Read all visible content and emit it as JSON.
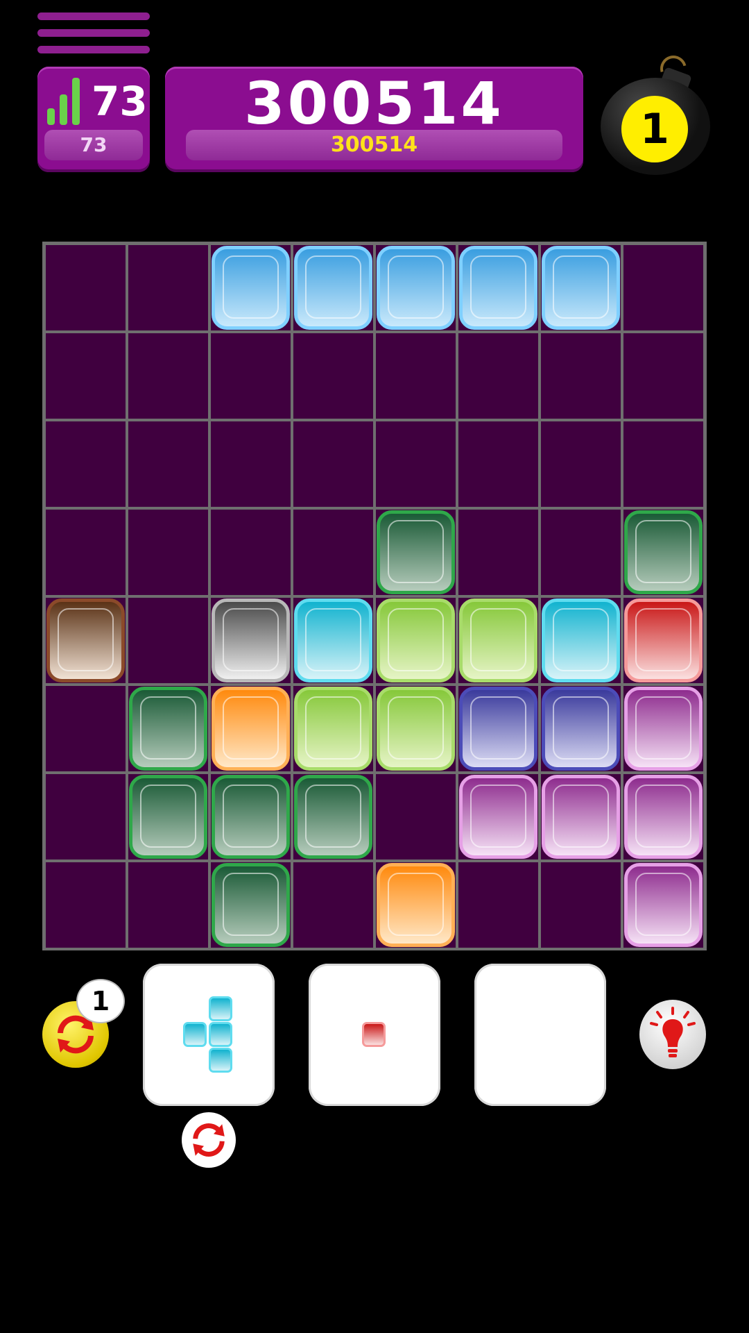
{
  "hud": {
    "level": "73",
    "level_sub": "73",
    "score": "300514",
    "best_score": "300514",
    "bombs": "1"
  },
  "board": {
    "cols": 8,
    "rows": 8,
    "cells": [
      [
        null,
        null,
        "lightblue",
        "lightblue",
        "lightblue",
        "lightblue",
        "lightblue",
        null
      ],
      [
        null,
        null,
        null,
        null,
        null,
        null,
        null,
        null
      ],
      [
        null,
        null,
        null,
        null,
        null,
        null,
        null,
        null
      ],
      [
        null,
        null,
        null,
        null,
        "darkgreen",
        null,
        null,
        "darkgreen"
      ],
      [
        "brown",
        null,
        "gray",
        "cyan",
        "lime",
        "lime",
        "cyan",
        "red"
      ],
      [
        null,
        "darkgreen",
        "orange",
        "lime",
        "lime",
        "indigo",
        "indigo",
        "purple"
      ],
      [
        null,
        "darkgreen",
        "darkgreen",
        "darkgreen",
        null,
        "purple",
        "purple",
        "purple"
      ],
      [
        null,
        null,
        "darkgreen",
        null,
        "orange",
        null,
        null,
        "purple"
      ]
    ]
  },
  "palette": {
    "lightblue": {
      "top": "#3a9ee0",
      "bottom": "#c9e9fb",
      "border": "#7fd0ff"
    },
    "darkgreen": {
      "top": "#1a5a36",
      "bottom": "#b6ccbc",
      "border": "#2fa84a"
    },
    "brown": {
      "top": "#5a3216",
      "bottom": "#f1e2d4",
      "border": "#8b4a2a"
    },
    "gray": {
      "top": "#4a4a4a",
      "bottom": "#f0f0f0",
      "border": "#b8b8b8"
    },
    "cyan": {
      "top": "#12b3cf",
      "bottom": "#d8f3f8",
      "border": "#5fdcef"
    },
    "lime": {
      "top": "#86c83a",
      "bottom": "#e6f4c6",
      "border": "#a8dc6a"
    },
    "red": {
      "top": "#c91818",
      "bottom": "#fbe0e0",
      "border": "#f59a9a"
    },
    "orange": {
      "top": "#ff8a0e",
      "bottom": "#ffe8c8",
      "border": "#ffb056"
    },
    "indigo": {
      "top": "#3a3a9c",
      "bottom": "#dcdcf4",
      "border": "#4c4cb8"
    },
    "purple": {
      "top": "#8e2c8e",
      "bottom": "#f6e2f6",
      "border": "#e6a0e6"
    }
  },
  "controls": {
    "rotate_count": "1",
    "pieces": [
      {
        "color": "cyan",
        "cells": [
          [
            1,
            0
          ],
          [
            0,
            1
          ],
          [
            1,
            1
          ],
          [
            1,
            2
          ]
        ]
      },
      {
        "color": "red",
        "cells": [
          [
            0,
            0
          ]
        ]
      },
      {
        "color": null,
        "cells": []
      }
    ]
  }
}
